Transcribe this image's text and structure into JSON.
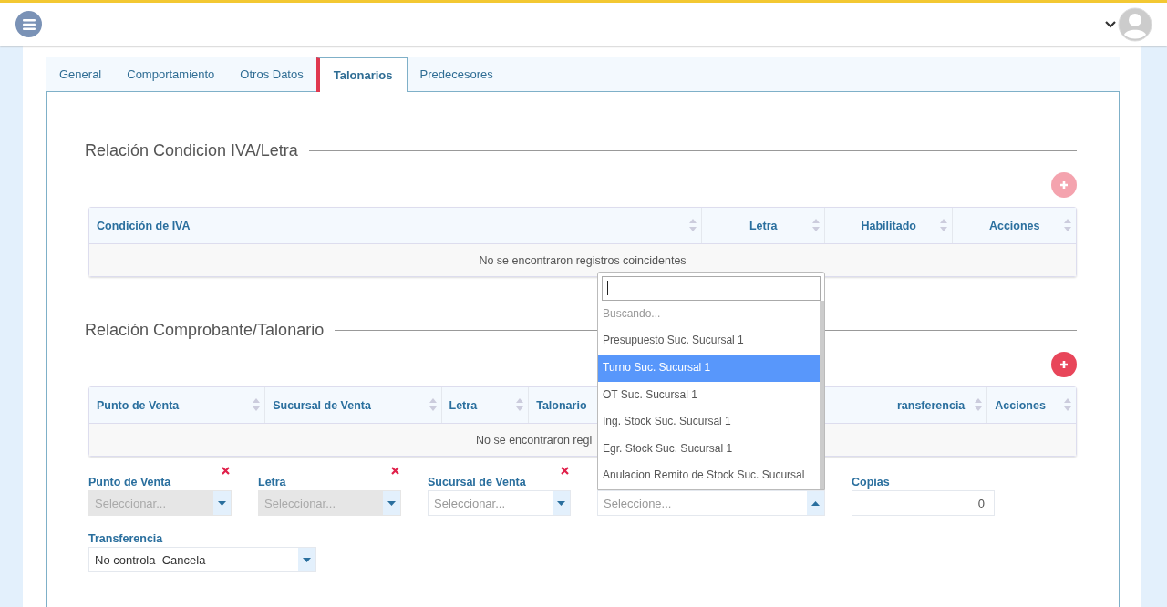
{
  "tabs": [
    {
      "label": "General",
      "selected": false
    },
    {
      "label": "Comportamiento",
      "selected": false
    },
    {
      "label": "Otros Datos",
      "selected": false
    },
    {
      "label": "Talonarios",
      "selected": true
    },
    {
      "label": "Predecesores",
      "selected": false
    }
  ],
  "sections": [
    {
      "title": "Relación Condicion IVA/Letra",
      "add_disabled": true,
      "columns": [
        {
          "label": "Condición de IVA",
          "sort_icon": true
        },
        {
          "label": "Letra",
          "sort_icon": true
        },
        {
          "label": "Habilitado",
          "sort_icon": true
        },
        {
          "label": "Acciones",
          "sort_icon": true
        }
      ],
      "empty_message": "No se encontraron registros coincidentes"
    },
    {
      "title": "Relación Comprobante/Talonario",
      "add_disabled": false,
      "columns": [
        {
          "label": "Punto de Venta",
          "sort_icon": true
        },
        {
          "label": "Sucursal de Venta",
          "sort_icon": true
        },
        {
          "label": "Letra",
          "sort_icon": true
        },
        {
          "label": "Talonario"
        },
        {
          "label": "ransferencia",
          "sort_icon": true
        },
        {
          "label": "Acciones",
          "sort_icon": true
        }
      ],
      "empty_message": "No se encontraron regi"
    }
  ],
  "fields": [
    {
      "kind": "select",
      "label": "Punto de Venta",
      "placeholder": "Seleccionar...",
      "disabled": true,
      "clear": true,
      "open": false
    },
    {
      "kind": "select",
      "label": "Letra",
      "placeholder": "Seleccionar...",
      "disabled": true,
      "clear": true,
      "open": false
    },
    {
      "kind": "select",
      "label": "Sucursal de Venta",
      "placeholder": "Seleccionar...",
      "disabled": false,
      "clear": true,
      "open": false
    },
    {
      "kind": "select",
      "placeholder": "Seleccione...",
      "disabled": false,
      "open": true
    },
    {
      "kind": "number",
      "label": "Copias",
      "value": "0"
    }
  ],
  "transfer_field": {
    "label": "Transferencia",
    "value": "No controla–Cancela"
  },
  "dropdown": {
    "status": "Buscando...",
    "options": [
      {
        "label": "Presupuesto Suc. Sucursal 1",
        "selected": false
      },
      {
        "label": "Turno Suc. Sucursal 1",
        "selected": true
      },
      {
        "label": "OT Suc. Sucursal 1",
        "selected": false
      },
      {
        "label": "Ing. Stock Suc. Sucursal 1",
        "selected": false
      },
      {
        "label": "Egr. Stock Suc. Sucursal 1",
        "selected": false
      },
      {
        "label": "Anulacion Remito de Stock Suc. Sucursal",
        "selected": false
      }
    ]
  }
}
